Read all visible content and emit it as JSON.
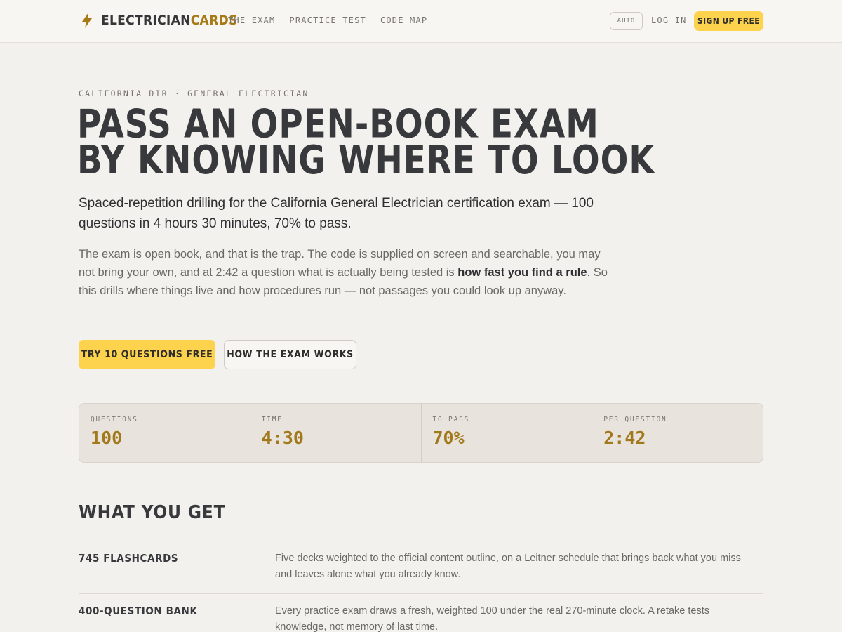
{
  "header": {
    "logo_main": "ELECTRICIAN",
    "logo_accent": "CARDS",
    "nav": [
      "THE EXAM",
      "PRACTICE TEST",
      "CODE MAP"
    ],
    "theme_toggle": "AUTO",
    "login": "LOG IN",
    "signup": "SIGN UP FREE"
  },
  "hero": {
    "eyebrow": "CALIFORNIA DIR · GENERAL ELECTRICIAN",
    "title_line1": "PASS AN OPEN-BOOK EXAM",
    "title_line2": "BY KNOWING WHERE TO LOOK",
    "lead": "Spaced-repetition drilling for the California General Electrician certification exam — 100 questions in 4 hours 30 minutes, 70% to pass.",
    "body_before": "The exam is open book, and that is the trap. The code is supplied on screen and searchable, you may not bring your own, and at 2:42 a question what is actually being tested is ",
    "body_strong": "how fast you find a rule",
    "body_after": ". So this drills where things live and how procedures run — not passages you could look up anyway.",
    "cta_primary": "TRY 10 QUESTIONS FREE",
    "cta_secondary": "HOW THE EXAM WORKS"
  },
  "stats": [
    {
      "label": "QUESTIONS",
      "value": "100"
    },
    {
      "label": "TIME",
      "value": "4:30"
    },
    {
      "label": "TO PASS",
      "value": "70%"
    },
    {
      "label": "PER QUESTION",
      "value": "2:42"
    }
  ],
  "features": {
    "heading": "WHAT YOU GET",
    "items": [
      {
        "title": "745 FLASHCARDS",
        "description": "Five decks weighted to the official content outline, on a Leitner schedule that brings back what you miss and leaves alone what you already know."
      },
      {
        "title": "400-QUESTION BANK",
        "description": "Every practice exam draws a fresh, weighted 100 under the real 270-minute clock. A retake tests knowledge, not memory of last time."
      }
    ]
  },
  "colors": {
    "accent": "#fdd34e",
    "brand_text": "#a77a16",
    "background": "#f3f1ed"
  },
  "icons": {
    "logo": "lightning-bolt-icon"
  }
}
